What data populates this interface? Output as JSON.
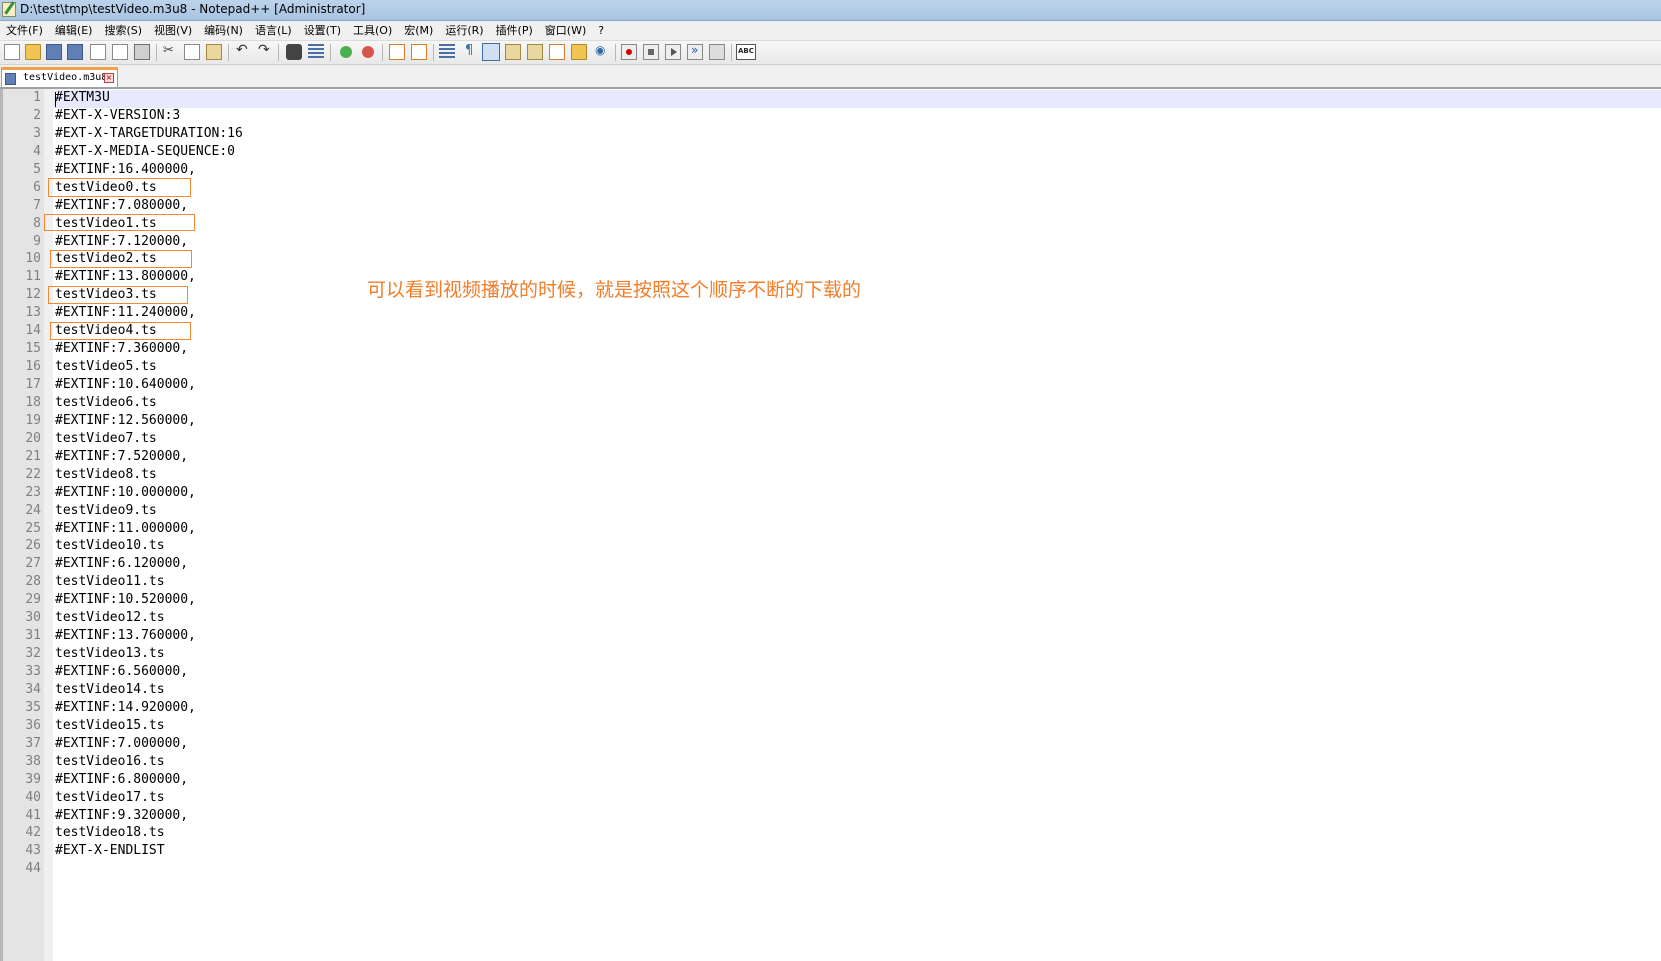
{
  "window": {
    "title": "D:\\test\\tmp\\testVideo.m3u8 - Notepad++ [Administrator]"
  },
  "menu": [
    "文件(F)",
    "编辑(E)",
    "搜索(S)",
    "视图(V)",
    "编码(N)",
    "语言(L)",
    "设置(T)",
    "工具(O)",
    "宏(M)",
    "运行(R)",
    "插件(P)",
    "窗口(W)",
    "?"
  ],
  "toolbar": {
    "icons": [
      "new-file-icon",
      "open-file-icon",
      "save-icon",
      "save-all-icon",
      "close-icon",
      "close-all-icon",
      "print-icon",
      "cut-icon",
      "copy-icon",
      "paste-icon",
      "undo-icon",
      "redo-icon",
      "find-icon",
      "replace-icon",
      "zoom-in-icon",
      "zoom-out-icon",
      "sync-vertical-icon",
      "sync-horizontal-icon",
      "word-wrap-icon",
      "show-all-chars-icon",
      "indent-guide-icon",
      "user-language-icon",
      "doc-map-icon",
      "function-list-icon",
      "folder-as-workspace-icon",
      "monitoring-icon",
      "record-macro-icon",
      "stop-recording-icon",
      "play-macro-icon",
      "run-macro-multiple-icon",
      "save-macro-icon",
      "spell-check-icon"
    ]
  },
  "tab": {
    "label": "testVideo.m3u8",
    "close": "×"
  },
  "editor": {
    "lines": [
      "#EXTM3U",
      "#EXT-X-VERSION:3",
      "#EXT-X-TARGETDURATION:16",
      "#EXT-X-MEDIA-SEQUENCE:0",
      "#EXTINF:16.400000,",
      "testVideo0.ts",
      "#EXTINF:7.080000,",
      "testVideo1.ts",
      "#EXTINF:7.120000,",
      "testVideo2.ts",
      "#EXTINF:13.800000,",
      "testVideo3.ts",
      "#EXTINF:11.240000,",
      "testVideo4.ts",
      "#EXTINF:7.360000,",
      "testVideo5.ts",
      "#EXTINF:10.640000,",
      "testVideo6.ts",
      "#EXTINF:12.560000,",
      "testVideo7.ts",
      "#EXTINF:7.520000,",
      "testVideo8.ts",
      "#EXTINF:10.000000,",
      "testVideo9.ts",
      "#EXTINF:11.000000,",
      "testVideo10.ts",
      "#EXTINF:6.120000,",
      "testVideo11.ts",
      "#EXTINF:10.520000,",
      "testVideo12.ts",
      "#EXTINF:13.760000,",
      "testVideo13.ts",
      "#EXTINF:6.560000,",
      "testVideo14.ts",
      "#EXTINF:14.920000,",
      "testVideo15.ts",
      "#EXTINF:7.000000,",
      "testVideo16.ts",
      "#EXTINF:6.800000,",
      "testVideo17.ts",
      "#EXTINF:9.320000,",
      "testVideo18.ts",
      "#EXT-X-ENDLIST",
      ""
    ],
    "line_numbers": [
      "1",
      "2",
      "3",
      "4",
      "5",
      "6",
      "7",
      "8",
      "9",
      "10",
      "11",
      "12",
      "13",
      "14",
      "15",
      "16",
      "17",
      "18",
      "19",
      "20",
      "21",
      "22",
      "23",
      "24",
      "25",
      "26",
      "27",
      "28",
      "29",
      "30",
      "31",
      "32",
      "33",
      "34",
      "35",
      "36",
      "37",
      "38",
      "39",
      "40",
      "41",
      "42",
      "43",
      "44"
    ]
  },
  "annotation": {
    "text": "可以看到视频播放的时候，就是按照这个顺序不断的下载的",
    "color": "#f07d2a"
  },
  "colors": {
    "tab_accent": "#f3a14b",
    "highlight_box": "#f08a3a",
    "current_line": "#e8e8ff"
  }
}
